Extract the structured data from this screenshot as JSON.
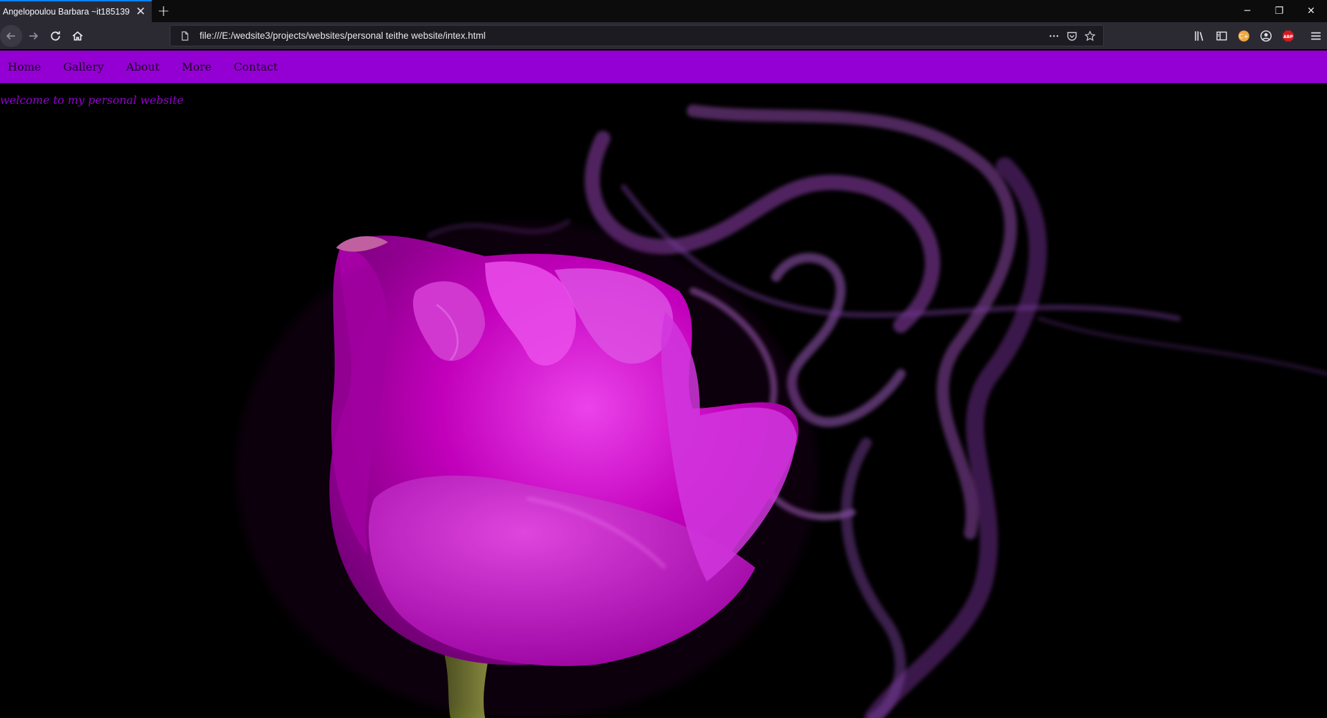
{
  "browser": {
    "tab_title": "Angelopoulou Barbara ~it185139",
    "tab_close": "✕",
    "new_tab": "+",
    "url": "file:///E:/wedsite3/projects/websites/personal teithe website/intex.html",
    "window_controls": {
      "minimize": "─",
      "restore": "❐",
      "close": "✕"
    },
    "extensions": [
      "library-icon",
      "sidebar-icon",
      "honey-extension-icon",
      "account-icon",
      "adblock-plus-icon",
      "menu-icon"
    ],
    "abp_label": "ABP"
  },
  "site": {
    "nav": [
      "Home",
      "Gallery",
      "About",
      "More",
      "Contact"
    ],
    "welcome": "welcome to my personal website"
  },
  "colors": {
    "nav_bg": "#9400d3",
    "welcome_text": "#9400d3",
    "page_bg": "#000000",
    "rose": "#d000d0",
    "smoke": "#a040c0"
  }
}
